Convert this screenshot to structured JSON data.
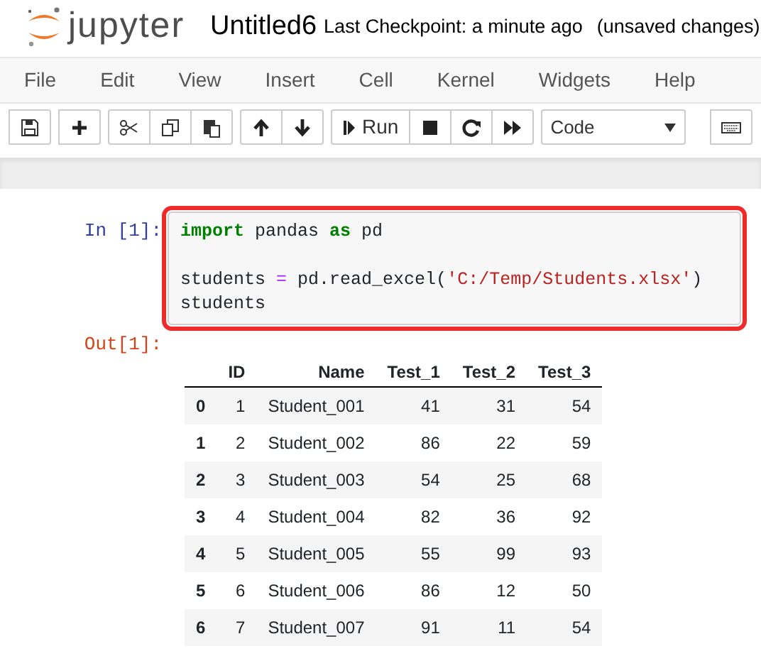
{
  "header": {
    "logo_text": "jupyter",
    "notebook_name": "Untitled6",
    "checkpoint": "Last Checkpoint: a minute ago",
    "save_status": "(unsaved changes)"
  },
  "menu": [
    "File",
    "Edit",
    "View",
    "Insert",
    "Cell",
    "Kernel",
    "Widgets",
    "Help"
  ],
  "toolbar": {
    "run_label": "Run",
    "cell_type": "Code"
  },
  "cell": {
    "prompt": "In [1]:",
    "highlighted": true,
    "blocks": [
      {
        "lines": [
          [
            {
              "kind": "keyword",
              "text": "import"
            },
            {
              "kind": "plain",
              "text": " pandas "
            },
            {
              "kind": "keyword",
              "text": "as"
            },
            {
              "kind": "plain",
              "text": " pd"
            }
          ]
        ]
      },
      {
        "lines": [
          [
            {
              "kind": "plain",
              "text": "students "
            },
            {
              "kind": "operator",
              "text": "="
            },
            {
              "kind": "plain",
              "text": " pd.read_excel("
            },
            {
              "kind": "string",
              "text": "'C:/Temp/Students.xlsx'"
            },
            {
              "kind": "plain",
              "text": ")"
            }
          ],
          [
            {
              "kind": "plain",
              "text": "students"
            }
          ]
        ]
      }
    ]
  },
  "output": {
    "prompt": "Out[1]:",
    "columns": [
      "ID",
      "Name",
      "Test_1",
      "Test_2",
      "Test_3"
    ],
    "rows": [
      {
        "index": "0",
        "cells": [
          "1",
          "Student_001",
          "41",
          "31",
          "54"
        ]
      },
      {
        "index": "1",
        "cells": [
          "2",
          "Student_002",
          "86",
          "22",
          "59"
        ]
      },
      {
        "index": "2",
        "cells": [
          "3",
          "Student_003",
          "54",
          "25",
          "68"
        ]
      },
      {
        "index": "3",
        "cells": [
          "4",
          "Student_004",
          "82",
          "36",
          "92"
        ]
      },
      {
        "index": "4",
        "cells": [
          "5",
          "Student_005",
          "55",
          "99",
          "93"
        ]
      },
      {
        "index": "5",
        "cells": [
          "6",
          "Student_006",
          "86",
          "12",
          "50"
        ]
      },
      {
        "index": "6",
        "cells": [
          "7",
          "Student_007",
          "91",
          "11",
          "54"
        ]
      }
    ]
  }
}
